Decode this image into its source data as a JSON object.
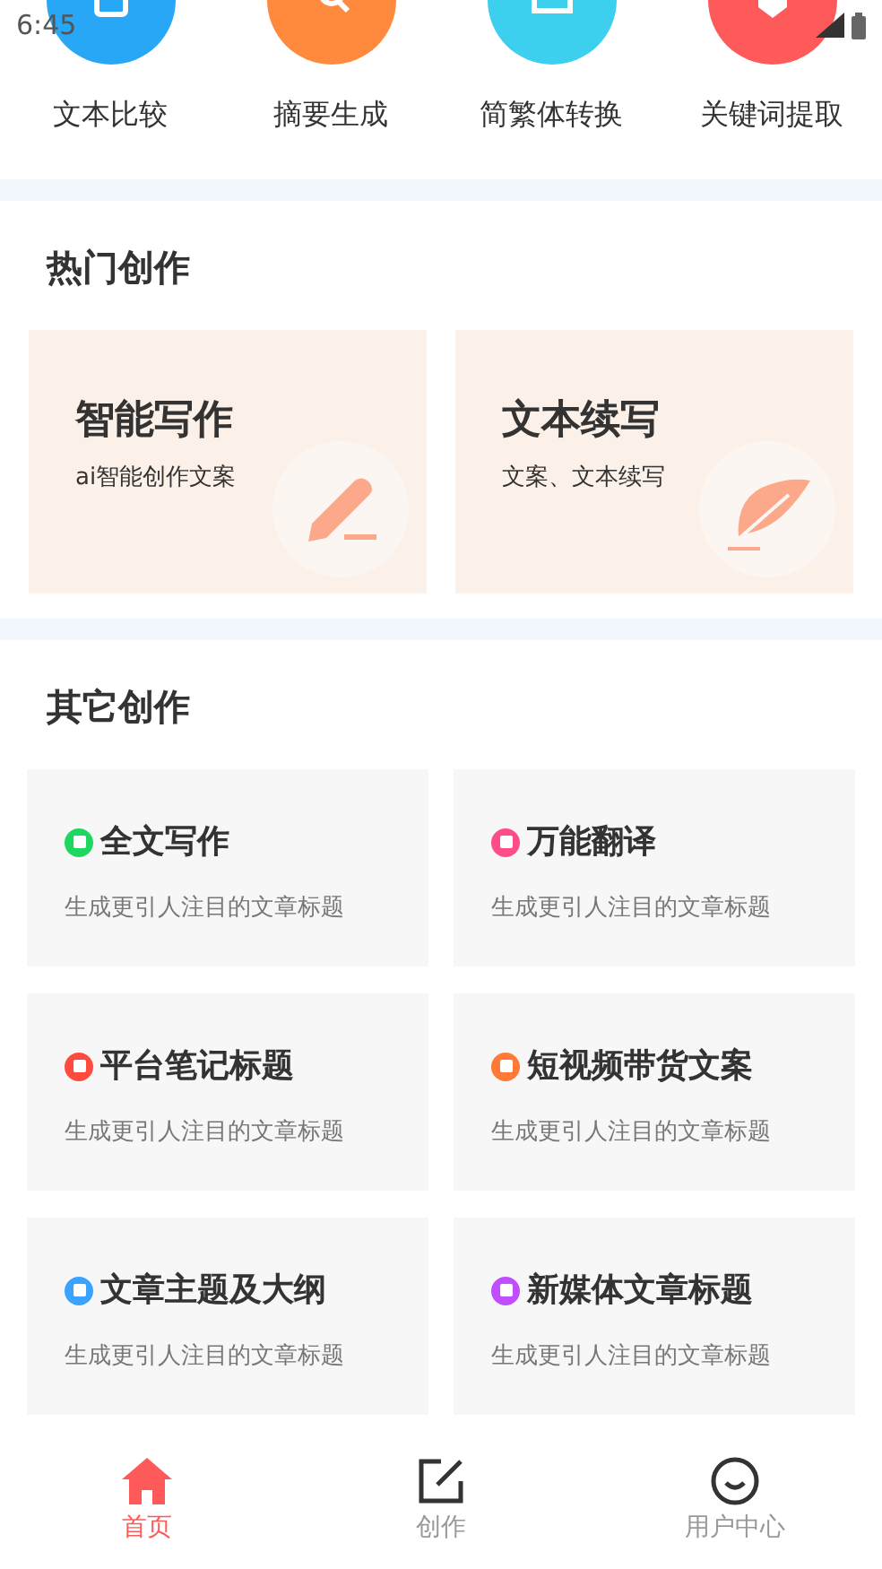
{
  "status_bar": {
    "time": "6:45"
  },
  "tools": [
    {
      "label": "文本比较",
      "color": "#27a7f5"
    },
    {
      "label": "摘要生成",
      "color": "#ff8a3d"
    },
    {
      "label": "简繁体转换",
      "color": "#3dcfee"
    },
    {
      "label": "关键词提取",
      "color": "#ff5a5a"
    }
  ],
  "hot_section": {
    "title": "热门创作",
    "cards": [
      {
        "kind": "pencil",
        "title": "智能写作",
        "subtitle": "ai智能创作文案"
      },
      {
        "kind": "feather",
        "title": "文本续写",
        "subtitle": "文案、文本续写"
      }
    ]
  },
  "other_section": {
    "title": "其它创作",
    "cards": [
      {
        "title": "全文写作",
        "subtitle": "生成更引人注目的文章标题",
        "color": "#1ed760"
      },
      {
        "title": "万能翻译",
        "subtitle": "生成更引人注目的文章标题",
        "color": "#ff4d8a"
      },
      {
        "title": "平台笔记标题",
        "subtitle": "生成更引人注目的文章标题",
        "color": "#ff4b3e"
      },
      {
        "title": "短视频带货文案",
        "subtitle": "生成更引人注目的文章标题",
        "color": "#ff7a35"
      },
      {
        "title": "文章主题及大纲",
        "subtitle": "生成更引人注目的文章标题",
        "color": "#3aa3ff"
      },
      {
        "title": "新媒体文章标题",
        "subtitle": "生成更引人注目的文章标题",
        "color": "#c04dff"
      }
    ]
  },
  "bottom_nav": [
    {
      "kind": "home",
      "label": "首页",
      "selected": true
    },
    {
      "kind": "edit",
      "label": "创作",
      "selected": false
    },
    {
      "kind": "user",
      "label": "用户中心",
      "selected": false
    }
  ]
}
